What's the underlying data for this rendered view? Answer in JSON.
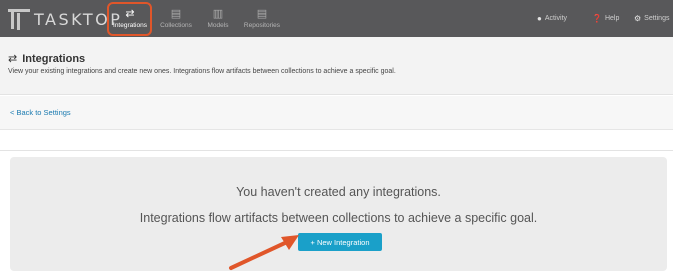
{
  "app": {
    "logo_text": "TASKTOP"
  },
  "nav": {
    "items": [
      {
        "label": "Integrations",
        "icon": "⇄",
        "icon_name": "arrows-exchange-icon",
        "active": true
      },
      {
        "label": "Collections",
        "icon": "▤",
        "icon_name": "collections-icon",
        "active": false
      },
      {
        "label": "Models",
        "icon": "▥",
        "icon_name": "models-icon",
        "active": false
      },
      {
        "label": "Repositories",
        "icon": "▤",
        "icon_name": "repositories-icon",
        "active": false
      }
    ],
    "right": [
      {
        "label": "Activity",
        "icon": "🔔",
        "icon_name": "bell-icon"
      },
      {
        "label": "Help",
        "icon": "❓",
        "icon_name": "help-icon"
      },
      {
        "label": "Settings",
        "icon": "⚙",
        "icon_name": "gear-icon"
      }
    ]
  },
  "header": {
    "title": "Integrations",
    "title_icon": "⇄",
    "description": "View your existing integrations and create new ones. Integrations flow artifacts between collections to achieve a specific goal."
  },
  "back": {
    "label": "< Back to Settings"
  },
  "empty_state": {
    "line1": "You haven't created any integrations.",
    "line2": "Integrations flow artifacts between collections to achieve a specific goal.",
    "button_label": "+ New Integration"
  },
  "colors": {
    "topbar": "#58585a",
    "highlight": "#e0562a",
    "button": "#1aa0c9",
    "link": "#1a7ab0"
  }
}
